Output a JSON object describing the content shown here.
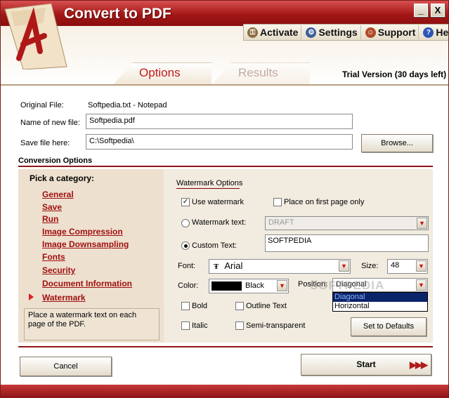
{
  "app": {
    "title": "Convert to PDF"
  },
  "window": {
    "minimize": "_",
    "close": "X"
  },
  "toolbar": {
    "activate": "Activate",
    "settings": "Settings",
    "support": "Support",
    "help": "Help"
  },
  "tabs": {
    "options": "Options",
    "results": "Results"
  },
  "trial": "Trial Version (30 days left)",
  "file": {
    "original_label": "Original File:",
    "original_value": "Softpedia.txt - Notepad",
    "name_label": "Name of new  file:",
    "name_value": "Softpedia.pdf",
    "save_label": "Save file here:",
    "save_value": "C:\\Softpedia\\",
    "browse": "Browse..."
  },
  "conversion": {
    "title": "Conversion Options",
    "pick": "Pick a category:",
    "categories": [
      "General",
      "Save",
      "Run",
      "Image Compression",
      "Image Downsampling",
      "Fonts",
      "Security",
      "Document Information",
      "Watermark"
    ],
    "selected": "Watermark",
    "help": "Place a watermark text on each page of the PDF."
  },
  "watermark": {
    "title": "Watermark Options",
    "use": "Use watermark",
    "use_checked": true,
    "first_page": "Place on first page only",
    "text_label": "Watermark text:",
    "text_value": "DRAFT",
    "custom_label": "Custom Text:",
    "custom_value": "SOFTPEDIA",
    "font_label": "Font:",
    "font_value": "Arial",
    "size_label": "Size:",
    "size_value": "48",
    "color_label": "Color:",
    "color_value": "Black",
    "color_hex": "#000000",
    "position_label": "Position:",
    "position_value": "Diagonal",
    "position_options": [
      "Diagonal",
      "Horizontal"
    ],
    "bold": "Bold",
    "outline": "Outline Text",
    "italic": "Italic",
    "semi": "Semi-transparent",
    "defaults": "Set to Defaults"
  },
  "overlay": "SOFTPEDIA",
  "buttons": {
    "cancel": "Cancel",
    "start": "Start"
  },
  "colors": {
    "accent": "#b01c1c",
    "panel": "#ede0cf",
    "link": "#a01010"
  }
}
